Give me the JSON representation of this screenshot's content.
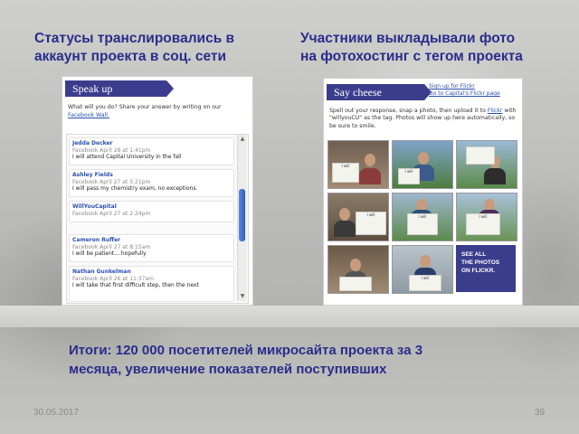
{
  "headings": {
    "left": [
      "Статусы транслировались в",
      "аккаунт проекта в соц. сети"
    ],
    "right": [
      "Участники выкладывали фото",
      "на фотохостинг с тегом проекта"
    ]
  },
  "speak_up": {
    "tab_label": "Speak up",
    "prompt_text": "What will you do? Share your answer by writing on our",
    "prompt_link": "Facebook Wall.",
    "posts": [
      {
        "name": "Jedda Decker",
        "meta": "Facebook April 28 at 1:41pm",
        "text": "I will attend Capital University in the fall"
      },
      {
        "name": "Ashley Fields",
        "meta": "Facebook April 27 at 5:21pm",
        "text": "I will pass my chemistry exam, no exceptions."
      },
      {
        "name": "WillYouCapital",
        "meta": "Facebook April 27 at 2:24pm",
        "text": ""
      },
      {
        "name": "Cameron Ruffer",
        "meta": "Facebook April 27 at 8:15am",
        "text": "I will be patient....hopefully"
      },
      {
        "name": "Nathan Gunkelman",
        "meta": "Facebook April 26 at 11:37am",
        "text": "I will take that first difficult step, then the next"
      }
    ]
  },
  "say_cheese": {
    "tab_label": "Say cheese",
    "links": [
      "Sign up for Flickr",
      "Go to Capital's Flickr page"
    ],
    "instructions_1": "Spell out your response, snap a photo, then upload it to",
    "instructions_link": "Flickr",
    "instructions_2": "with \"willyouCU\" as the tag. Photos will show up here automatically, so be sure to smile.",
    "see_all": [
      "SEE ALL",
      "THE PHOTOS",
      "ON FLICKR."
    ],
    "photo_signs": [
      "I will",
      "I will",
      "",
      "I will",
      "I will",
      "I will",
      "",
      "I will"
    ]
  },
  "result": [
    "Итоги: 120 000 посетителей микросайта проекта за 3",
    "месяца, увеличение показателей поступивших"
  ],
  "footer": {
    "date": "30.05.2017",
    "page": "39"
  },
  "colors": {
    "accent": "#2a2d8a",
    "tab": "#3b3d8c",
    "link": "#2b4fb0"
  }
}
